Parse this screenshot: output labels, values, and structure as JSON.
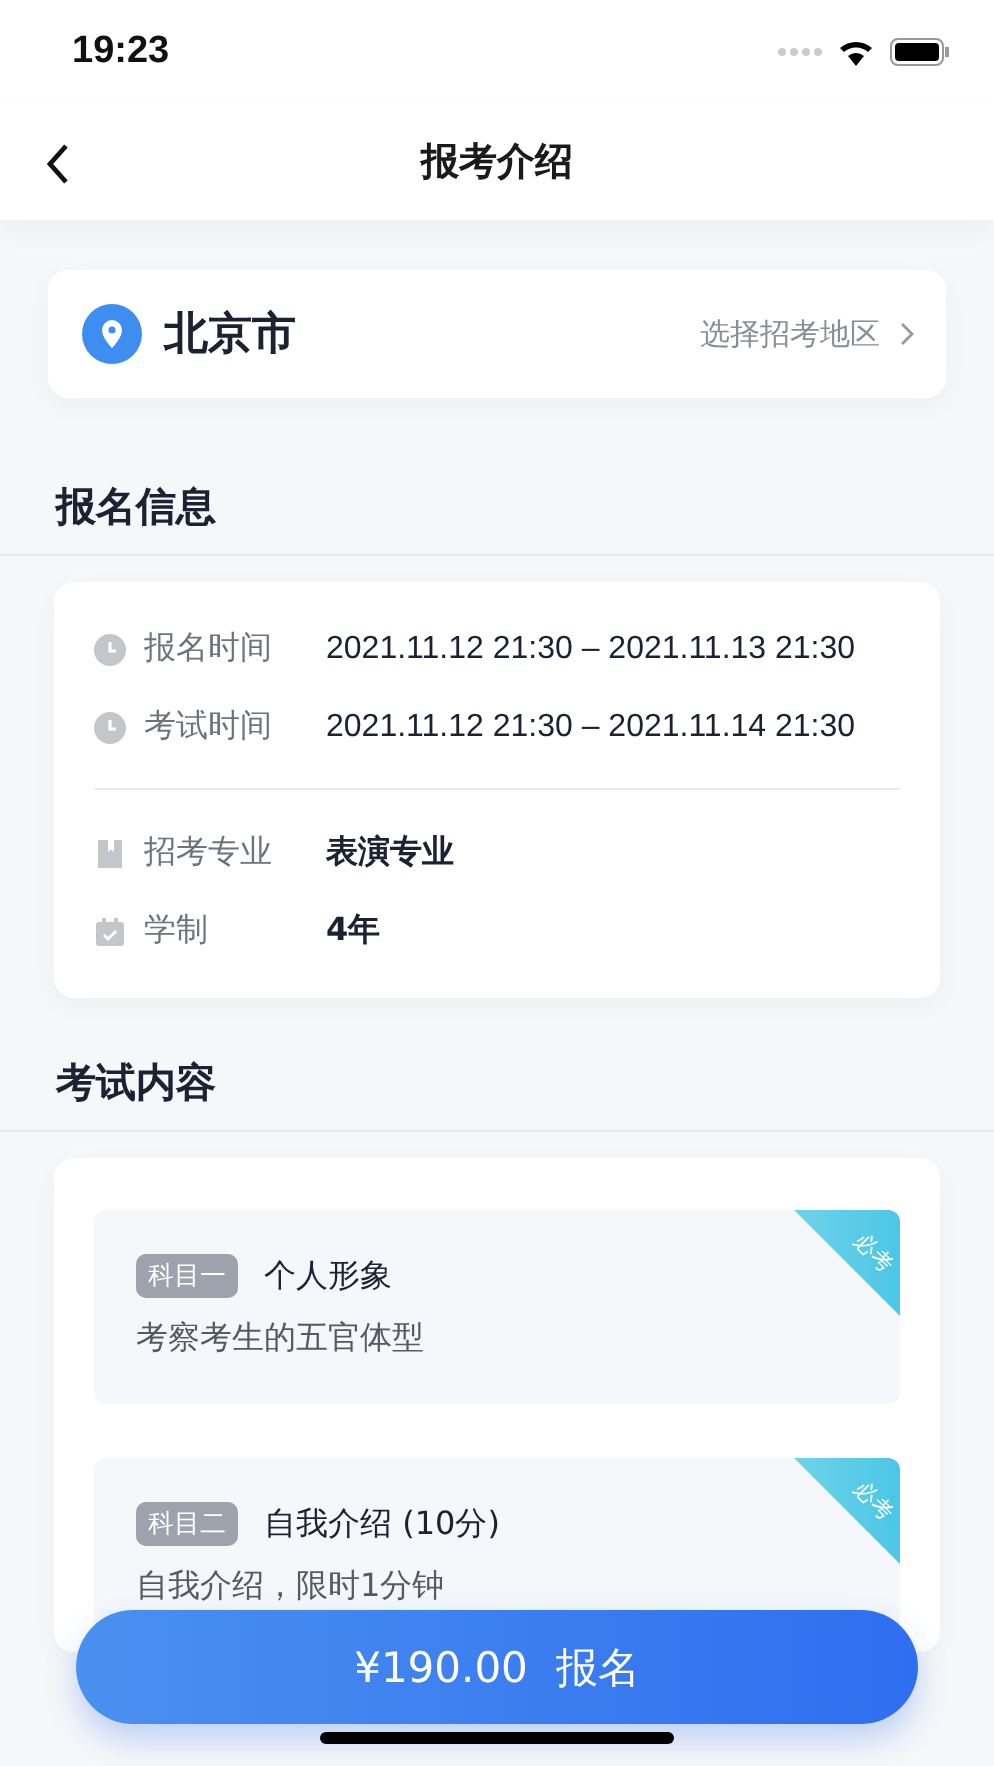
{
  "status_bar": {
    "time": "19:23"
  },
  "nav": {
    "title": "报考介绍"
  },
  "location": {
    "city": "北京市",
    "action": "选择招考地区"
  },
  "sections": [
    {
      "title": "报名信息"
    },
    {
      "title": "考试内容"
    }
  ],
  "info_groups": [
    [
      {
        "label": "报名时间",
        "value": "2021.11.12 21:30 – 2021.11.13 21:30"
      },
      {
        "label": "考试时间",
        "value": "2021.11.12 21:30 – 2021.11.14 21:30"
      }
    ],
    [
      {
        "label": "招考专业",
        "value": "表演专业"
      },
      {
        "label": "学制",
        "value": "4年"
      }
    ]
  ],
  "subjects": [
    {
      "tag": "科目一",
      "title": "个人形象",
      "desc": "考察考生的五官体型",
      "badge": "必考"
    },
    {
      "tag": "科目二",
      "title": "自我介绍 (10分)",
      "desc": "自我介绍，限时1分钟",
      "badge": "必考"
    }
  ],
  "signup_button": {
    "price": "¥190.00",
    "label": "报名"
  }
}
